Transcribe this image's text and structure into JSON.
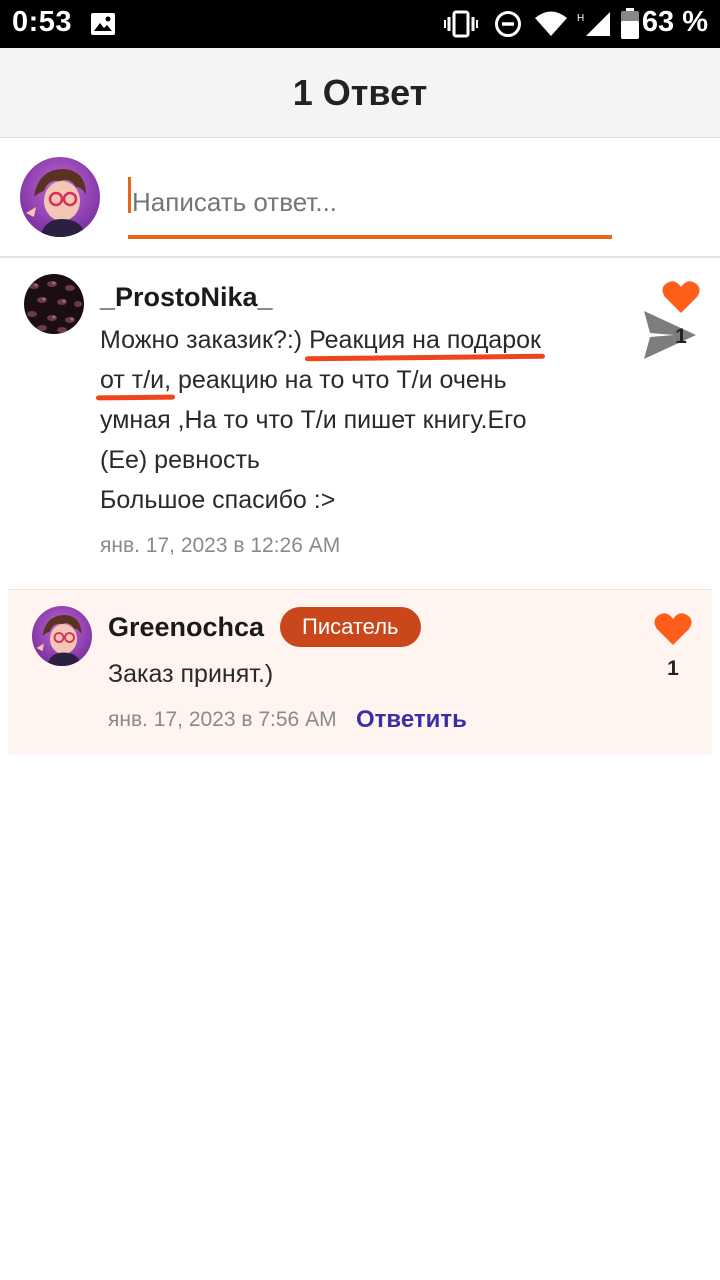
{
  "status_bar": {
    "time": "0:53",
    "battery": "63 %",
    "icons": [
      "image-icon",
      "vibrate-icon",
      "dnd-icon",
      "wifi-icon",
      "signal-icon",
      "battery-icon"
    ]
  },
  "header": {
    "title": "1 Ответ"
  },
  "composer": {
    "placeholder": "Написать ответ...",
    "send_icon": "send-icon"
  },
  "comments": [
    {
      "author": "_ProstoNika_",
      "body_lines": [
        "Можно заказик?:)",
        "Реакция на подарок",
        "от т/и,",
        " реакцию на то что Т/и очень",
        "умная ,На то что Т/и пишет книгу.Его",
        "(Ее) ревность",
        "Большое спасибо :>"
      ],
      "date": "янв. 17, 2023 в 12:26 AM",
      "likes": "1"
    },
    {
      "author": "Greenochca",
      "badge": "Писатель",
      "body": "Заказ принят.)",
      "date": "янв. 17, 2023 в 7:56 AM",
      "reply_label": "Ответить",
      "likes": "1"
    }
  ],
  "colors": {
    "accent": "#e8651a",
    "heart": "#ff5e1a",
    "badge": "#c9471b",
    "reply_link": "#3b2fa8",
    "reply_bg": "#fff4f0"
  }
}
